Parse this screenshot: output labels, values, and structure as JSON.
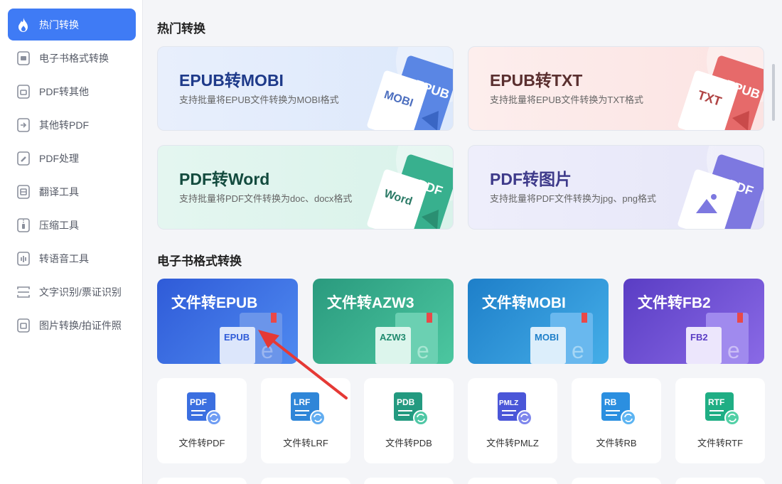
{
  "sidebar": {
    "items": [
      {
        "label": "热门转换",
        "icon": "flame-icon",
        "active": true
      },
      {
        "label": "电子书格式转换",
        "icon": "ebook-icon"
      },
      {
        "label": "PDF转其他",
        "icon": "pdf-export-icon"
      },
      {
        "label": "其他转PDF",
        "icon": "pdf-import-icon"
      },
      {
        "label": "PDF处理",
        "icon": "pdf-edit-icon"
      },
      {
        "label": "翻译工具",
        "icon": "translate-icon"
      },
      {
        "label": "压缩工具",
        "icon": "compress-icon"
      },
      {
        "label": "转语音工具",
        "icon": "audio-icon"
      },
      {
        "label": "文字识别/票证识别",
        "icon": "ocr-icon"
      },
      {
        "label": "图片转换/拍证件照",
        "icon": "image-icon"
      }
    ]
  },
  "sections": {
    "hot": "热门转换",
    "ebook": "电子书格式转换"
  },
  "hot_cards": [
    {
      "title": "EPUB转MOBI",
      "desc": "支持批量将EPUB文件转换为MOBI格式",
      "tag": "MOBI",
      "back": "EPUB",
      "title_color": "#1e3a8a",
      "bg": "#e3edfb",
      "accent": "#4d7fe0"
    },
    {
      "title": "EPUB转TXT",
      "desc": "支持批量将EPUB文件转换为TXT格式",
      "tag": "TXT",
      "back": "EPUB",
      "title_color": "#5a2f2f",
      "bg": "#fce9e8",
      "accent": "#e25c5c"
    },
    {
      "title": "PDF转Word",
      "desc": "支持批量将PDF文件转换为doc、docx格式",
      "tag": "Word",
      "back": "PDF",
      "title_color": "#134b3e",
      "bg": "#e0f4ee",
      "accent": "#2fb08c"
    },
    {
      "title": "PDF转图片",
      "desc": "支持批量将PDF文件转换为jpg、png格式",
      "tag": "",
      "back": "PDF",
      "title_color": "#3e3a8a",
      "bg": "#ebebfa",
      "accent": "#7c7ce0"
    }
  ],
  "category_cards": [
    {
      "title": "文件转EPUB",
      "tag": "EPUB",
      "color1": "#2f5bd8",
      "color2": "#4f8af0"
    },
    {
      "title": "文件转AZW3",
      "tag": "AZW3",
      "color1": "#2a9a7e",
      "color2": "#4cc7a0"
    },
    {
      "title": "文件转MOBI",
      "tag": "MOBI",
      "color1": "#1e7fc9",
      "color2": "#45aee8"
    },
    {
      "title": "文件转FB2",
      "tag": "FB2",
      "color1": "#5a3dc4",
      "color2": "#8a6ae6"
    }
  ],
  "tools": [
    {
      "label": "文件转PDF",
      "tag": "PDF",
      "color": "#3b6fe0"
    },
    {
      "label": "文件转LRF",
      "tag": "LRF",
      "color": "#2f86d8"
    },
    {
      "label": "文件转PDB",
      "tag": "PDB",
      "color": "#239a80"
    },
    {
      "label": "文件转PMLZ",
      "tag": "PMLZ",
      "color": "#4a56d8"
    },
    {
      "label": "文件转RB",
      "tag": "RB",
      "color": "#2b8fe0"
    },
    {
      "label": "文件转RTF",
      "tag": "RTF",
      "color": "#1fae84"
    }
  ]
}
